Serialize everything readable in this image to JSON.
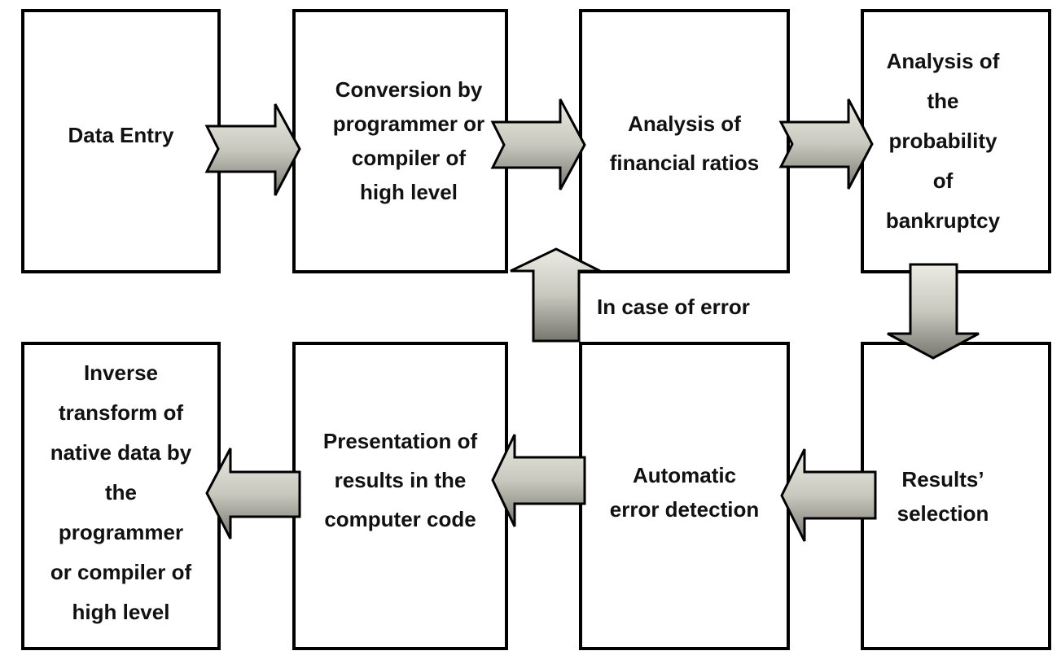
{
  "boxes": [
    {
      "id": "data-entry",
      "lines": [
        "Data Entry"
      ]
    },
    {
      "id": "conversion",
      "lines": [
        "Conversion by",
        "programmer or",
        "compiler of",
        "high level"
      ]
    },
    {
      "id": "financial-ratios",
      "lines": [
        "Analysis of",
        "financial ratios"
      ]
    },
    {
      "id": "bankruptcy",
      "lines": [
        "Analysis of",
        "the",
        "probability",
        "of",
        "bankruptcy"
      ]
    },
    {
      "id": "inverse-transform",
      "lines": [
        "Inverse",
        "transform of",
        "native data by",
        "the",
        "programmer",
        "or compiler of",
        "high level"
      ]
    },
    {
      "id": "presentation",
      "lines": [
        "Presentation of",
        "results in the",
        "computer code"
      ]
    },
    {
      "id": "error-detection",
      "lines": [
        "Automatic",
        "error detection"
      ]
    },
    {
      "id": "results-selection",
      "lines": [
        "Results’",
        "selection"
      ]
    }
  ],
  "error_label": "In case of error",
  "colors": {
    "arrow_light": "#ecebe3",
    "arrow_dark": "#77776f",
    "border": "#000000"
  }
}
